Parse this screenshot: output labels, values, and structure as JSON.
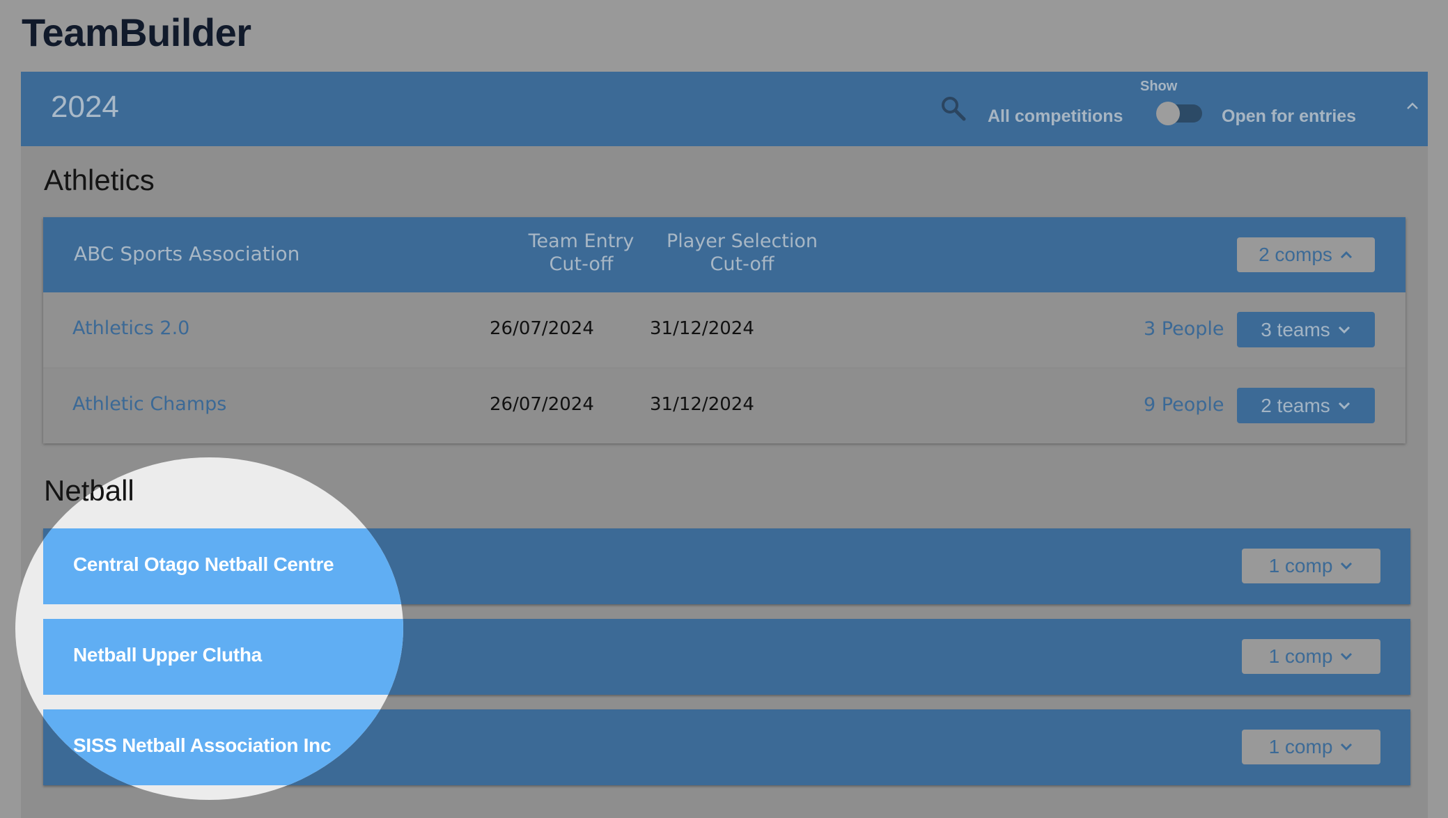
{
  "app": {
    "title": "TeamBuilder"
  },
  "year_bar": {
    "year": "2024",
    "show_label": "Show",
    "filter_all": "All competitions",
    "filter_open": "Open for entries",
    "toggle_on": false
  },
  "sections": {
    "athletics": {
      "heading": "Athletics",
      "org": {
        "name": "ABC Sports Association",
        "col_team_entry_line1": "Team Entry",
        "col_team_entry_line2": "Cut-off",
        "col_player_sel_line1": "Player Selection",
        "col_player_sel_line2": "Cut-off",
        "comps_label": "2 comps",
        "competitions": [
          {
            "name": "Athletics 2.0",
            "team_entry": "26/07/2024",
            "player_selection": "31/12/2024",
            "people": "3 People",
            "teams": "3 teams"
          },
          {
            "name": "Athletic Champs",
            "team_entry": "26/07/2024",
            "player_selection": "31/12/2024",
            "people": "9 People",
            "teams": "2 teams"
          }
        ]
      }
    },
    "netball": {
      "heading": "Netball",
      "orgs": [
        {
          "name": "Central Otago Netball Centre",
          "comps_label": "1 comp"
        },
        {
          "name": "Netball Upper Clutha",
          "comps_label": "1 comp"
        },
        {
          "name": "SISS Netball Association Inc",
          "comps_label": "1 comp"
        }
      ]
    }
  },
  "colors": {
    "primary": "#3c6a96",
    "overlay": "#999999",
    "highlight": "#60aef3",
    "spotlight_bg": "#ececec"
  }
}
